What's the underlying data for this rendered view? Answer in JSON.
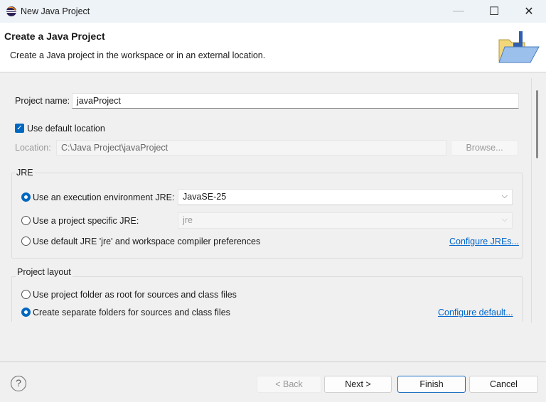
{
  "window": {
    "title": "New Java Project",
    "minimize": "—",
    "maximize": "☐",
    "close": "✕",
    "icon": "eclipse-icon"
  },
  "header": {
    "title": "Create a Java Project",
    "description": "Create a Java project in the workspace or in an external location.",
    "banner_icon": "folder-icon"
  },
  "form": {
    "project_name_label": "Project name:",
    "project_name_value": "javaProject",
    "use_default_location_label": "Use default location",
    "use_default_location_checked": true,
    "location_label": "Location:",
    "location_value": "C:\\Java Project\\javaProject",
    "browse_label": "Browse..."
  },
  "jre": {
    "group_label": "JRE",
    "options": [
      {
        "label": "Use an execution environment JRE:",
        "selected": true,
        "value": "JavaSE-25"
      },
      {
        "label": "Use a project specific JRE:",
        "selected": false,
        "value": "jre"
      },
      {
        "label": "Use default JRE 'jre' and workspace compiler preferences",
        "selected": false
      }
    ],
    "configure_link": "Configure JREs..."
  },
  "layout": {
    "group_label": "Project layout",
    "options": [
      {
        "label": "Use project folder as root for sources and class files",
        "selected": false
      },
      {
        "label": "Create separate folders for sources and class files",
        "selected": true
      }
    ],
    "configure_link": "Configure default..."
  },
  "footer": {
    "help": "?",
    "back": "< Back",
    "next": "Next >",
    "finish": "Finish",
    "cancel": "Cancel"
  }
}
